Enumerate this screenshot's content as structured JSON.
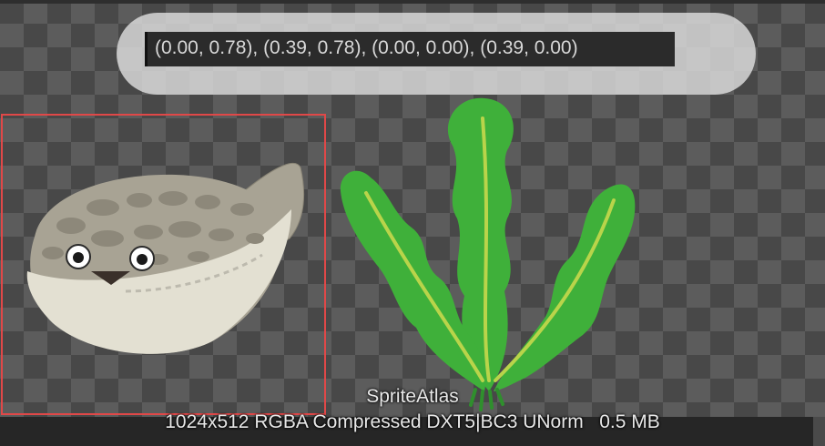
{
  "uv_overlay": {
    "coordinates_text": "(0.00, 0.78), (0.39, 0.78), (0.00, 0.00), (0.39, 0.00)"
  },
  "atlas": {
    "name": "SpriteAtlas",
    "info": "1024x512 RGBA Compressed DXT5|BC3 UNorm   0.5 MB"
  },
  "sprites": [
    {
      "icon": "pufferfish-icon",
      "selected": true
    },
    {
      "icon": "seaweed-icon",
      "selected": false
    }
  ],
  "colors": {
    "selection": "#e04848",
    "seaweed": "#3fb03a",
    "seaweed_vein": "#b9d44a",
    "fish_body": "#a8a394",
    "fish_belly": "#e3e0d2"
  }
}
